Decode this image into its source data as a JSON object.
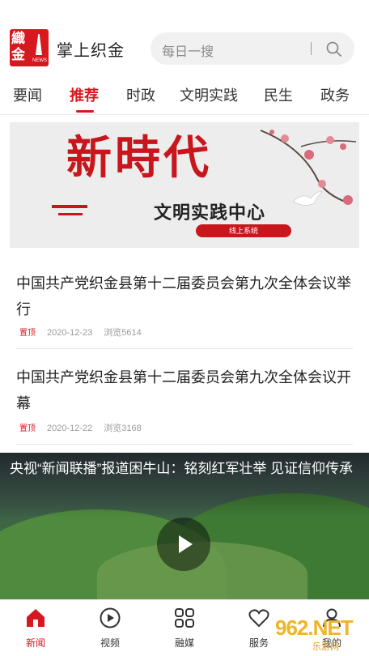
{
  "header": {
    "logo_line1": "織",
    "logo_line2": "金",
    "logo_tag": "NEWS",
    "app_title": "掌上织金",
    "search_placeholder": "每日一搜"
  },
  "tabs": [
    {
      "label": "要闻"
    },
    {
      "label": "推荐"
    },
    {
      "label": "时政"
    },
    {
      "label": "文明实践"
    },
    {
      "label": "民生"
    },
    {
      "label": "政务"
    }
  ],
  "active_tab": "推荐",
  "banner": {
    "calligraphy": "新時代",
    "subtitle": "文明实践中心",
    "pill": "线上系统"
  },
  "articles": [
    {
      "title": "中国共产党织金县第十二届委员会第九次全体会议举行",
      "badge": "置顶",
      "date": "2020-12-23",
      "views": "浏览5614"
    },
    {
      "title": "中国共产党织金县第十二届委员会第九次全体会议开幕",
      "badge": "置顶",
      "date": "2020-12-22",
      "views": "浏览3168"
    }
  ],
  "video": {
    "title": "央视“新闻联播”报道困牛山：铭刻红军壮举 见证信仰传承"
  },
  "bottom_nav": [
    {
      "label": "新闻",
      "icon": "home-icon"
    },
    {
      "label": "视频",
      "icon": "play-circle-icon"
    },
    {
      "label": "融媒",
      "icon": "grid-icon"
    },
    {
      "label": "服务",
      "icon": "heart-icon"
    },
    {
      "label": "我的",
      "icon": "user-icon"
    }
  ],
  "watermark": {
    "line1": "962.NET",
    "line2": "乐游网"
  },
  "colors": {
    "accent": "#d7191f",
    "text": "#222222",
    "muted": "#9a9a9a"
  }
}
